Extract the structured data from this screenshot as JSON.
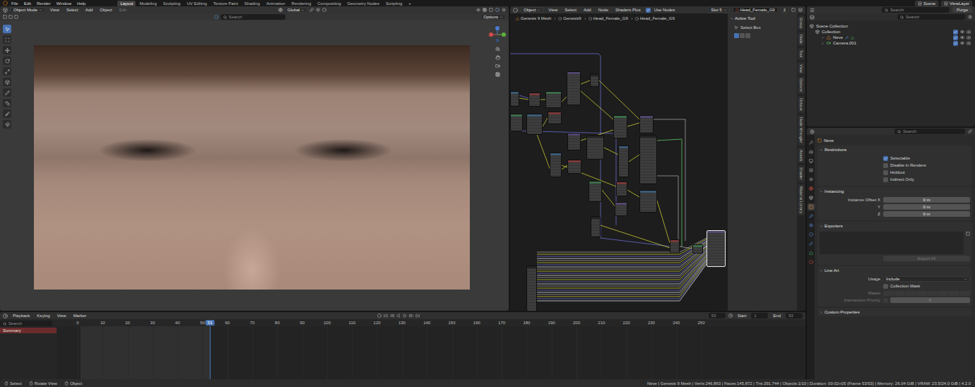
{
  "menubar": {
    "menus": [
      "File",
      "Edit",
      "Render",
      "Window",
      "Help"
    ],
    "workspaces": [
      {
        "label": "Layout",
        "selected": true
      },
      {
        "label": "Modeling",
        "selected": false
      },
      {
        "label": "Sculpting",
        "selected": false
      },
      {
        "label": "UV Editing",
        "selected": false
      },
      {
        "label": "Texture Paint",
        "selected": false
      },
      {
        "label": "Shading",
        "selected": false
      },
      {
        "label": "Animation",
        "selected": false
      },
      {
        "label": "Rendering",
        "selected": false
      },
      {
        "label": "Compositing",
        "selected": false
      },
      {
        "label": "Geometry Nodes",
        "selected": false
      },
      {
        "label": "Scripting",
        "selected": false
      }
    ],
    "add_workspace": "+",
    "scene": "Scene",
    "view_layer": "ViewLayer"
  },
  "viewport": {
    "mode": "Object Mode",
    "menus": [
      "View",
      "Select",
      "Add",
      "Object"
    ],
    "edit_toggle": {
      "label": "Edit",
      "disabled": true
    },
    "orientation": "Global",
    "search_placeholder": "Search",
    "options": "Options",
    "tools": [
      {
        "selected": true
      },
      {
        "selected": false
      },
      {
        "selected": false
      },
      {
        "selected": false
      },
      {
        "selected": false
      },
      {
        "selected": false
      },
      {
        "selected": false
      },
      {
        "selected": false
      },
      {
        "selected": false
      },
      {
        "selected": false
      }
    ]
  },
  "node_editor": {
    "type": "Object",
    "menus": [
      "View",
      "Select",
      "Add",
      "Node"
    ],
    "addon": "Shaders Plus",
    "use_nodes": {
      "label": "Use Nodes",
      "checked": true
    },
    "slot": "Slot 5",
    "material": "Head_Female_G9",
    "users": "2",
    "breadcrumbs": [
      "Genesis 9 Mesh",
      "Genesis9",
      "Head_Female_G9",
      "Head_Female_G9"
    ],
    "sidebar": {
      "title": "Active Tool",
      "expanded": true,
      "tool": "Select Box"
    },
    "tabs": [
      "Group",
      "Node",
      "Tool",
      "View",
      "Options",
      "Octane",
      "Node Wrangler",
      "Assets",
      "Shader",
      "Material Library"
    ]
  },
  "outliner": {
    "search_placeholder": "Search",
    "purge": "Purge",
    "items": [
      {
        "label": "Scene Collection",
        "depth": 0,
        "kind": "scene"
      },
      {
        "label": "Collection",
        "depth": 1,
        "kind": "collection",
        "checked": true,
        "visible": true
      },
      {
        "label": "Neve",
        "depth": 2,
        "kind": "mesh",
        "expanded": false,
        "checked": true,
        "visible": true
      },
      {
        "label": "Camera.001",
        "depth": 2,
        "kind": "camera",
        "expanded": false,
        "checked": true,
        "visible": true
      }
    ]
  },
  "properties": {
    "search_placeholder": "Search",
    "object": "Neve",
    "tabs": [
      {
        "color": "#9a9a9a",
        "selected": false
      },
      {
        "color": "#b8b8b8",
        "selected": false
      },
      {
        "color": "#b8b8b8",
        "selected": false
      },
      {
        "color": "#b8b8b8",
        "selected": false
      },
      {
        "color": "#b8b8b8",
        "selected": false
      },
      {
        "color": "#d9534a",
        "selected": false
      },
      {
        "color": "#e0e0e0",
        "selected": false
      },
      {
        "color": "#e8902e",
        "selected": true
      },
      {
        "color": "#5b8fdc",
        "selected": false
      },
      {
        "color": "#5b8fdc",
        "selected": false
      },
      {
        "color": "#5b8fdc",
        "selected": false
      },
      {
        "color": "#5b8fdc",
        "selected": false
      },
      {
        "color": "#4ec26e",
        "selected": false
      },
      {
        "color": "#d9534a",
        "selected": false
      }
    ],
    "sections": [
      {
        "title": "Restrictions",
        "expanded": true,
        "rows": [
          {
            "kind": "checkbox",
            "label": "Selectable",
            "checked": true
          },
          {
            "kind": "checkbox",
            "label": "Disable in Renders",
            "checked": false
          },
          {
            "kind": "checkbox",
            "label": "Holdout",
            "checked": false
          },
          {
            "kind": "checkbox",
            "label": "Indirect Only",
            "checked": false
          }
        ]
      },
      {
        "title": "Instancing",
        "expanded": true,
        "rows": [
          {
            "kind": "field",
            "label": "Instance Offset X",
            "value": "0 m"
          },
          {
            "kind": "field",
            "label": "Y",
            "value": "0 m"
          },
          {
            "kind": "field",
            "label": "Z",
            "value": "0 m"
          }
        ]
      },
      {
        "title": "Exporters",
        "expanded": true,
        "rows": [
          {
            "kind": "list"
          },
          {
            "kind": "button",
            "label": "Export All",
            "disabled": true
          }
        ]
      },
      {
        "title": "Line Art",
        "expanded": true,
        "rows": [
          {
            "kind": "dropdown",
            "label": "Usage",
            "value": "Include"
          },
          {
            "kind": "checkbox",
            "label": "Collection Mask",
            "checked": false
          },
          {
            "kind": "masks",
            "label": "Masks",
            "disabled": true
          },
          {
            "kind": "priority",
            "label": "Intersection Priority",
            "checked": false,
            "value": "0",
            "disabled": true
          }
        ]
      },
      {
        "title": "Custom Properties",
        "expanded": false,
        "rows": []
      }
    ]
  },
  "timeline": {
    "menus": [
      "Playback",
      "Keying",
      "View",
      "Marker"
    ],
    "current_frame": "53",
    "start_label": "Start",
    "start": "1",
    "end_label": "End",
    "end": "53",
    "search_placeholder": "Search",
    "channels": [
      {
        "label": "Summary",
        "selected": true
      }
    ],
    "ruler": [
      "0",
      "10",
      "20",
      "30",
      "40",
      "50",
      "60",
      "70",
      "80",
      "90",
      "100",
      "110",
      "120",
      "130",
      "140",
      "150",
      "160",
      "170",
      "180",
      "190",
      "200",
      "210",
      "220",
      "230",
      "240",
      "250"
    ]
  },
  "status_bar": {
    "hints": [
      "Select",
      "Rotate View",
      "Object"
    ],
    "stats": "Neve | Genesis 9 Mesh | Verts:246,863 | Faces:145,872 | Tris:291,744 | Objects:1/10 | Duration: 00:02+05 (Frame 53/53) | Memory: 26.04 GiB | VRAM: 23.5/24.0 GiB | 4.2.0"
  }
}
